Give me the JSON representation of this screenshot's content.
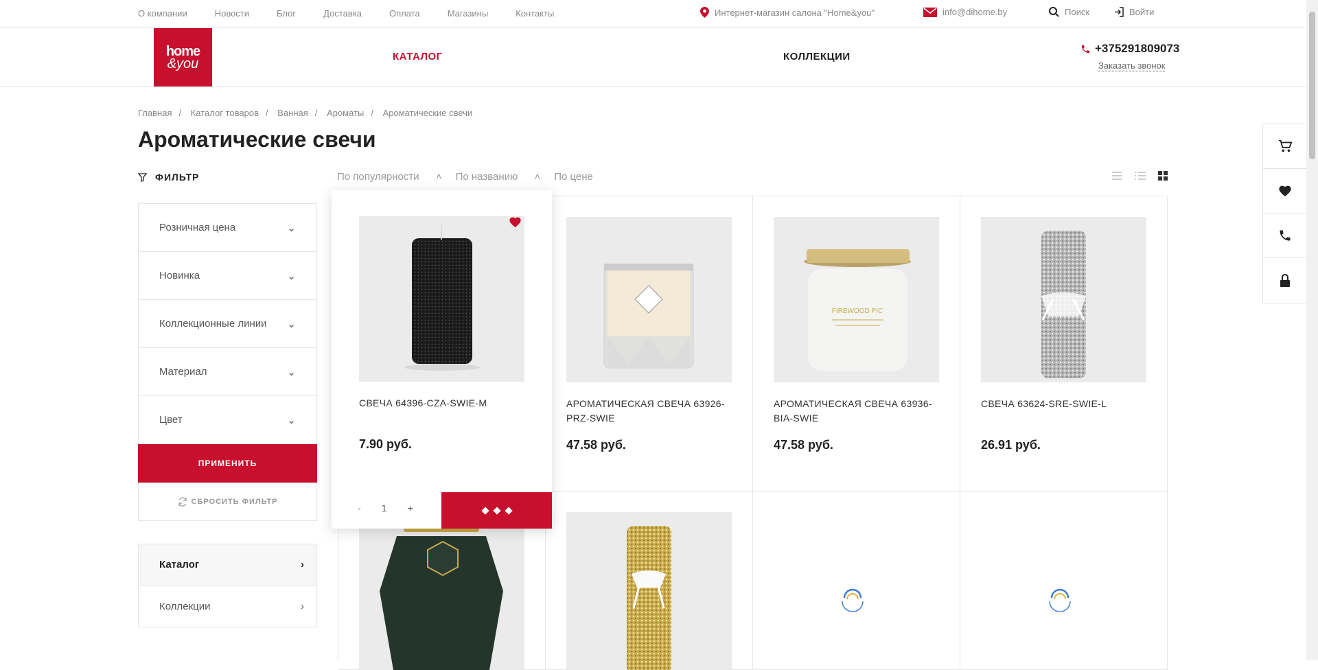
{
  "colors": {
    "accent": "#c8102e"
  },
  "top_nav": [
    "О компании",
    "Новости",
    "Блог",
    "Доставка",
    "Оплата",
    "Магазины",
    "Контакты"
  ],
  "top_info": {
    "store": "Интернет-магазин салона \"Home&you\"",
    "email": "info@dihome.by",
    "search": "Поиск",
    "login": "Войти"
  },
  "logo": {
    "line1": "home",
    "line2": "&you"
  },
  "main_nav": {
    "catalog": "КАТАЛОГ",
    "collections": "КОЛЛЕКЦИИ"
  },
  "contact": {
    "phone": "+375291809073",
    "callback": "Заказать звонок"
  },
  "breadcrumb": [
    "Главная",
    "Каталог товаров",
    "Ванная",
    "Ароматы",
    "Ароматические свечи"
  ],
  "page_title": "Ароматические свечи",
  "filter": {
    "title": "ФИЛЬТР",
    "items": [
      "Розничная цена",
      "Новинка",
      "Коллекционные линии",
      "Материал",
      "Цвет"
    ],
    "apply": "ПРИМЕНИТЬ",
    "reset": "СБРОСИТЬ ФИЛЬТР"
  },
  "side_menu": [
    "Каталог",
    "Коллекции"
  ],
  "sort": [
    "По популярности",
    "По названию",
    "По цене"
  ],
  "products": [
    {
      "title": "СВЕЧА 64396-CZA-SWIE-M",
      "price": "7.90 руб.",
      "icon": "black-candle"
    },
    {
      "title": "АРОМАТИЧЕСКАЯ СВЕЧА 63926-PRZ-SWIE",
      "price": "47.58 руб.",
      "icon": "glass-candle"
    },
    {
      "title": "АРОМАТИЧЕСКАЯ СВЕЧА 63936-BIA-SWIE",
      "price": "47.58 руб.",
      "icon": "jar-candle"
    },
    {
      "title": "СВЕЧА 63624-SRE-SWIE-L",
      "price": "26.91 руб.",
      "icon": "silver-candle"
    }
  ],
  "quantity": {
    "minus": "-",
    "value": "1",
    "plus": "+"
  }
}
